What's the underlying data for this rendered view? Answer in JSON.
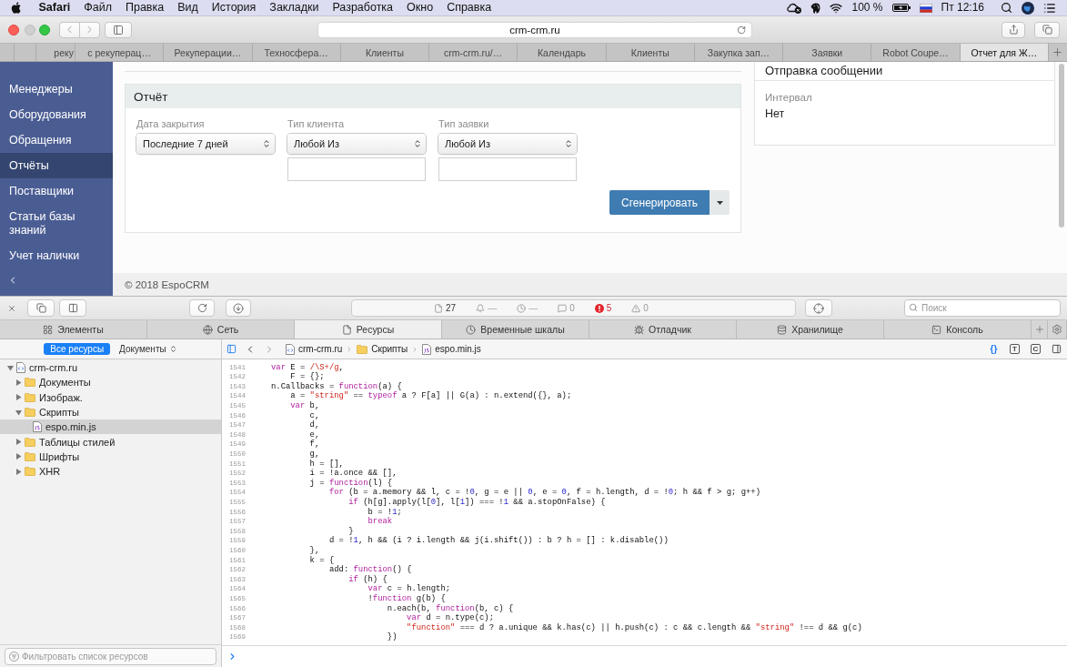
{
  "menu_bar": {
    "app": "Safari",
    "menus": [
      "Файл",
      "Правка",
      "Вид",
      "История",
      "Закладки",
      "Разработка",
      "Окно",
      "Справка"
    ],
    "battery": "100 %",
    "clock": "Пт 12:16"
  },
  "browser": {
    "address": "crm-crm.ru",
    "tabs": [
      {
        "label": "реку",
        "selected": false
      },
      {
        "label": "с рекуперац…",
        "selected": false
      },
      {
        "label": "Рекуперации…",
        "selected": false
      },
      {
        "label": "Техносфера…",
        "selected": false
      },
      {
        "label": "Клиенты",
        "selected": false
      },
      {
        "label": "crm-crm.ru/…",
        "selected": false
      },
      {
        "label": "Календарь",
        "selected": false
      },
      {
        "label": "Клиенты",
        "selected": false
      },
      {
        "label": "Закупка зап…",
        "selected": false
      },
      {
        "label": "Заявки",
        "selected": false
      },
      {
        "label": "Robot Coupe…",
        "selected": false
      },
      {
        "label": "Отчет для Ж…",
        "selected": true
      }
    ]
  },
  "crm": {
    "nav": [
      {
        "label": "Менеджеры",
        "selected": false
      },
      {
        "label": "Оборудования",
        "selected": false
      },
      {
        "label": "Обращения",
        "selected": false
      },
      {
        "label": "Отчёты",
        "selected": true
      },
      {
        "label": "Поставщики",
        "selected": false
      },
      {
        "label": "Статьи базы знаний",
        "selected": false
      },
      {
        "label": "Учет налички",
        "selected": false
      }
    ],
    "report": {
      "title": "Отчёт",
      "filters": [
        {
          "kind": "select",
          "label": "Дата закрытия",
          "value": "Последние 7 дней"
        },
        {
          "kind": "combo",
          "label": "Тип клиента",
          "value": "Любой Из"
        },
        {
          "kind": "combo",
          "label": "Тип заявки",
          "value": "Любой Из"
        }
      ],
      "button": "Сгенерировать"
    },
    "side_panel": {
      "title": "Отправка сообщении",
      "label": "Интервал",
      "value": "Нет"
    },
    "footer": "© 2018 EspoCRM"
  },
  "devtools": {
    "dashboard": [
      {
        "kind": "resources",
        "value": "27"
      },
      {
        "kind": "network",
        "value": "—"
      },
      {
        "kind": "time",
        "value": "—"
      },
      {
        "kind": "logs",
        "value": "0"
      },
      {
        "kind": "errors",
        "value": "5"
      },
      {
        "kind": "warnings",
        "value": "0"
      }
    ],
    "search": {
      "placeholder": "Поиск"
    },
    "tabs": [
      {
        "kind": "elements",
        "label": "Элементы",
        "selected": false
      },
      {
        "kind": "network",
        "label": "Сеть",
        "selected": false
      },
      {
        "kind": "resources",
        "label": "Ресурсы",
        "selected": true
      },
      {
        "kind": "timelines",
        "label": "Временные шкалы",
        "selected": false
      },
      {
        "kind": "debugger",
        "label": "Отладчик",
        "selected": false
      },
      {
        "kind": "storage",
        "label": "Хранилище",
        "selected": false
      },
      {
        "kind": "console",
        "label": "Консоль",
        "selected": false
      }
    ],
    "scope": {
      "label": "Все ресурсы",
      "selected": true
    },
    "grouping": "Документы",
    "breadcrumbs": [
      {
        "kind": "domain",
        "label": "crm-crm.ru"
      },
      {
        "kind": "folder",
        "label": "Скрипты"
      },
      {
        "kind": "script",
        "label": "espo.min.js"
      }
    ],
    "editor_buttons": [
      {
        "label": "{}",
        "selected": true
      },
      {
        "label": "T",
        "selected": false
      },
      {
        "label": "C",
        "selected": false
      }
    ],
    "tree": [
      {
        "kind": "domain",
        "label": "crm-crm.ru",
        "expanded": true,
        "selected": false,
        "children": [
          {
            "kind": "folder",
            "label": "Документы",
            "expanded": false,
            "selected": false
          },
          {
            "kind": "folder",
            "label": "Изображ.",
            "expanded": false,
            "selected": false
          },
          {
            "kind": "folder",
            "label": "Скрипты",
            "expanded": true,
            "selected": false,
            "children": [
              {
                "kind": "script",
                "label": "espo.min.js",
                "selected": true
              }
            ]
          },
          {
            "kind": "folder",
            "label": "Таблицы стилей",
            "expanded": false,
            "selected": false
          },
          {
            "kind": "folder",
            "label": "Шрифты",
            "expanded": false,
            "selected": false
          },
          {
            "kind": "folder",
            "label": "XHR",
            "expanded": false,
            "selected": false
          }
        ]
      }
    ],
    "filter": {
      "placeholder": "Фильтровать список ресурсов"
    },
    "code": [
      {
        "number": "1541",
        "tokens": [
          {
            "kind": "keyword",
            "text": "var"
          },
          {
            "kind": "plain",
            "text": " E = "
          },
          {
            "kind": "regex",
            "text": "/\\S+/g"
          },
          {
            "kind": "plain",
            "text": ","
          }
        ]
      },
      {
        "number": "1542",
        "tokens": [
          {
            "kind": "plain",
            "text": "    F = {};"
          }
        ]
      },
      {
        "number": "1543",
        "tokens": [
          {
            "kind": "plain",
            "text": "n.Callbacks = "
          },
          {
            "kind": "keyword",
            "text": "function"
          },
          {
            "kind": "plain",
            "text": "(a) {"
          }
        ]
      },
      {
        "number": "1544",
        "tokens": [
          {
            "kind": "plain",
            "text": "    a = "
          },
          {
            "kind": "string",
            "text": "\"string\""
          },
          {
            "kind": "plain",
            "text": " == "
          },
          {
            "kind": "keyword",
            "text": "typeof"
          },
          {
            "kind": "plain",
            "text": " a ? F[a] || G(a) : n.extend({}, a);"
          }
        ]
      },
      {
        "number": "1545",
        "tokens": [
          {
            "kind": "keyword",
            "text": "    var"
          },
          {
            "kind": "plain",
            "text": " b,"
          }
        ]
      },
      {
        "number": "1546",
        "tokens": [
          {
            "kind": "plain",
            "text": "        c,"
          }
        ]
      },
      {
        "number": "1547",
        "tokens": [
          {
            "kind": "plain",
            "text": "        d,"
          }
        ]
      },
      {
        "number": "1548",
        "tokens": [
          {
            "kind": "plain",
            "text": "        e,"
          }
        ]
      },
      {
        "number": "1549",
        "tokens": [
          {
            "kind": "plain",
            "text": "        f,"
          }
        ]
      },
      {
        "number": "1550",
        "tokens": [
          {
            "kind": "plain",
            "text": "        g,"
          }
        ]
      },
      {
        "number": "1551",
        "tokens": [
          {
            "kind": "plain",
            "text": "        h = [],"
          }
        ]
      },
      {
        "number": "1552",
        "tokens": [
          {
            "kind": "plain",
            "text": "        i = !a.once && [],"
          }
        ]
      },
      {
        "number": "1553",
        "tokens": [
          {
            "kind": "plain",
            "text": "        j = "
          },
          {
            "kind": "keyword",
            "text": "function"
          },
          {
            "kind": "plain",
            "text": "(l) {"
          }
        ]
      },
      {
        "number": "1554",
        "tokens": [
          {
            "kind": "keyword",
            "text": "            for"
          },
          {
            "kind": "plain",
            "text": " (b = a.memory && l, c = !"
          },
          {
            "kind": "number",
            "text": "0"
          },
          {
            "kind": "plain",
            "text": ", g = e || "
          },
          {
            "kind": "number",
            "text": "0"
          },
          {
            "kind": "plain",
            "text": ", e = "
          },
          {
            "kind": "number",
            "text": "0"
          },
          {
            "kind": "plain",
            "text": ", f = h.length, d = !"
          },
          {
            "kind": "number",
            "text": "0"
          },
          {
            "kind": "plain",
            "text": "; h && f > g; g++)"
          }
        ]
      },
      {
        "number": "1555",
        "tokens": [
          {
            "kind": "keyword",
            "text": "                if"
          },
          {
            "kind": "plain",
            "text": " (h[g].apply(l["
          },
          {
            "kind": "number",
            "text": "0"
          },
          {
            "kind": "plain",
            "text": "], l["
          },
          {
            "kind": "number",
            "text": "1"
          },
          {
            "kind": "plain",
            "text": "]) === !"
          },
          {
            "kind": "number",
            "text": "1"
          },
          {
            "kind": "plain",
            "text": " && a.stopOnFalse) {"
          }
        ]
      },
      {
        "number": "1556",
        "tokens": [
          {
            "kind": "plain",
            "text": "                    b = !"
          },
          {
            "kind": "number",
            "text": "1"
          },
          {
            "kind": "plain",
            "text": ";"
          }
        ]
      },
      {
        "number": "1557",
        "tokens": [
          {
            "kind": "keyword",
            "text": "                    break"
          }
        ]
      },
      {
        "number": "1558",
        "tokens": [
          {
            "kind": "plain",
            "text": "                }"
          }
        ]
      },
      {
        "number": "1559",
        "tokens": [
          {
            "kind": "plain",
            "text": "            d = !"
          },
          {
            "kind": "number",
            "text": "1"
          },
          {
            "kind": "plain",
            "text": ", h && (i ? i.length && j(i.shift()) : b ? h = [] : k.disable())"
          }
        ]
      },
      {
        "number": "1560",
        "tokens": [
          {
            "kind": "plain",
            "text": "        },"
          }
        ]
      },
      {
        "number": "1561",
        "tokens": [
          {
            "kind": "plain",
            "text": "        k = {"
          }
        ]
      },
      {
        "number": "1562",
        "tokens": [
          {
            "kind": "plain",
            "text": "            add: "
          },
          {
            "kind": "keyword",
            "text": "function"
          },
          {
            "kind": "plain",
            "text": "() {"
          }
        ]
      },
      {
        "number": "1563",
        "tokens": [
          {
            "kind": "keyword",
            "text": "                if"
          },
          {
            "kind": "plain",
            "text": " (h) {"
          }
        ]
      },
      {
        "number": "1564",
        "tokens": [
          {
            "kind": "keyword",
            "text": "                    var"
          },
          {
            "kind": "plain",
            "text": " c = h.length;"
          }
        ]
      },
      {
        "number": "1565",
        "tokens": [
          {
            "kind": "plain",
            "text": "                    !"
          },
          {
            "kind": "keyword",
            "text": "function"
          },
          {
            "kind": "plain",
            "text": " g(b) {"
          }
        ]
      },
      {
        "number": "1566",
        "tokens": [
          {
            "kind": "plain",
            "text": "                        n.each(b, "
          },
          {
            "kind": "keyword",
            "text": "function"
          },
          {
            "kind": "plain",
            "text": "(b, c) {"
          }
        ]
      },
      {
        "number": "1567",
        "tokens": [
          {
            "kind": "keyword",
            "text": "                            var"
          },
          {
            "kind": "plain",
            "text": " d = n.type(c);"
          }
        ]
      },
      {
        "number": "1568",
        "tokens": [
          {
            "kind": "string",
            "text": "                            \"function\""
          },
          {
            "kind": "plain",
            "text": " === d ? a.unique && k.has(c) || h.push(c) : c && c.length && "
          },
          {
            "kind": "string",
            "text": "\"string\""
          },
          {
            "kind": "plain",
            "text": " !== d && g(c)"
          }
        ]
      },
      {
        "number": "1569",
        "tokens": [
          {
            "kind": "plain",
            "text": "                        })"
          }
        ]
      }
    ]
  }
}
